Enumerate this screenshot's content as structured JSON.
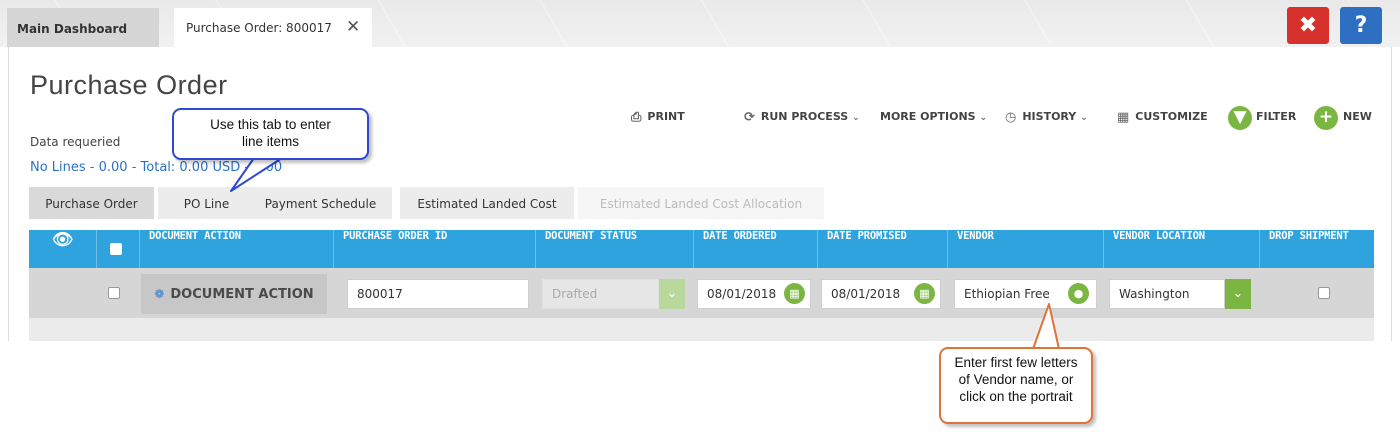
{
  "top_tabs": {
    "main_dashboard": "Main Dashboard",
    "purchase_order": "Purchase Order: 800017",
    "close_tab_glyph": "✕"
  },
  "window_buttons": {
    "close": "✖",
    "help": "?"
  },
  "page": {
    "title": "Purchase Order",
    "data_required": "Data requeried",
    "summary": "No Lines - 0.00 - Total: 0.00 USD - 0.00"
  },
  "toolbar": {
    "print": "PRINT",
    "run_process": "RUN PROCESS",
    "more_options": "MORE OPTIONS",
    "history": "HISTORY",
    "customize": "CUSTOMIZE",
    "filter": "FILTER",
    "new": "NEW"
  },
  "form_tabs": [
    "Purchase Order",
    "PO Line",
    "Payment Schedule",
    "Estimated Landed Cost",
    "Estimated Landed Cost Allocation"
  ],
  "grid": {
    "columns": [
      "DOCUMENT ACTION",
      "PURCHASE ORDER ID",
      "DOCUMENT STATUS",
      "DATE ORDERED",
      "DATE PROMISED",
      "VENDOR",
      "VENDOR LOCATION",
      "DROP SHIPMENT"
    ],
    "row": {
      "document_action": "DOCUMENT ACTION",
      "purchase_order_id": "800017",
      "document_status": "Drafted",
      "date_ordered": "08/01/2018",
      "date_promised": "08/01/2018",
      "vendor": "Ethiopian Free",
      "vendor_location": "Washington",
      "drop_shipment": false
    }
  },
  "callouts": {
    "tab_hint_line1": "Use this tab to enter",
    "tab_hint_line2": "line items",
    "vendor_hint_line1": "Enter first few letters",
    "vendor_hint_line2": "of Vendor name, or",
    "vendor_hint_line3": "click on the portrait"
  },
  "colors": {
    "header_blue": "#2fa3dd",
    "accent_green": "#7cb642",
    "close_red": "#d6312c",
    "help_blue": "#2f6fc2",
    "link_blue": "#2a72c6",
    "callout_blue": "#2f49d6",
    "callout_orange": "#e0733a"
  }
}
